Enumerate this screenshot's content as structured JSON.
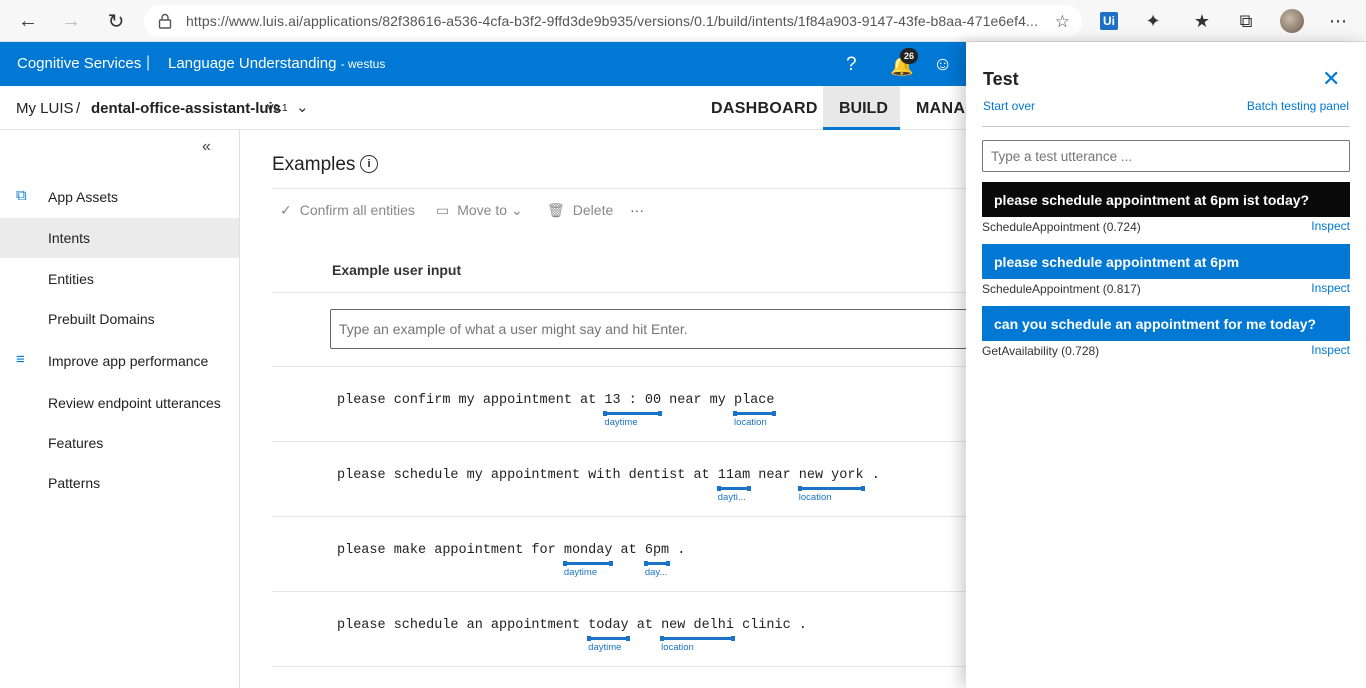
{
  "browser": {
    "url": "https://www.luis.ai/applications/82f38616-a536-4cfa-b3f2-9ffd3de9b935/versions/0.1/build/intents/1f84a903-9147-43fe-b8aa-471e6ef4...",
    "ext_label": "Ui"
  },
  "header": {
    "brand": "Cognitive Services",
    "separator": "|",
    "product": "Language Understanding",
    "region": "- westus",
    "notifications_count": "26"
  },
  "breadcrumb": {
    "root": "My LUIS",
    "separator": "/",
    "app_name": "dental-office-assistant-luis",
    "version": "V0.1"
  },
  "top_tabs": {
    "dashboard": "DASHBOARD",
    "build": "BUILD",
    "manage": "MANAG"
  },
  "sidebar": {
    "items": [
      {
        "label": "App Assets"
      },
      {
        "label": "Intents"
      },
      {
        "label": "Entities"
      },
      {
        "label": "Prebuilt Domains"
      },
      {
        "label": "Improve app performance"
      },
      {
        "label": "Review endpoint utterances"
      },
      {
        "label": "Features"
      },
      {
        "label": "Patterns"
      }
    ]
  },
  "main": {
    "title": "Examples",
    "toolbar": {
      "confirm": "Confirm all entities",
      "move": "Move to",
      "delete": "Delete",
      "more": "···"
    },
    "column_header": "Example user input",
    "input_placeholder": "Type an example of what a user might say and hit Enter.",
    "utterances": [
      {
        "parts": [
          {
            "text": "please confirm my appointment at "
          },
          {
            "text": "13 : 00",
            "entity": "daytime"
          },
          {
            "text": " near my "
          },
          {
            "text": "place",
            "entity": "location"
          }
        ]
      },
      {
        "parts": [
          {
            "text": "please schedule my appointment with dentist at "
          },
          {
            "text": "11am",
            "entity": "dayti..."
          },
          {
            "text": " near "
          },
          {
            "text": "new york",
            "entity": "location"
          },
          {
            "text": " ."
          }
        ]
      },
      {
        "parts": [
          {
            "text": "please make appointment for "
          },
          {
            "text": "monday",
            "entity": "daytime"
          },
          {
            "text": " at "
          },
          {
            "text": "6pm",
            "entity": "day..."
          },
          {
            "text": " ."
          }
        ]
      },
      {
        "parts": [
          {
            "text": "please schedule an appointment "
          },
          {
            "text": "today",
            "entity": "daytime"
          },
          {
            "text": " at "
          },
          {
            "text": "new delhi",
            "entity": "location"
          },
          {
            "text": " clinic ."
          }
        ]
      }
    ]
  },
  "test_panel": {
    "title": "Test",
    "start_over": "Start over",
    "batch": "Batch testing panel",
    "input_placeholder": "Type a test utterance ...",
    "results": [
      {
        "utterance": "please schedule appointment at 6pm ist today?",
        "intent": "ScheduleAppointment (0.724)",
        "inspect": "Inspect"
      },
      {
        "utterance": "please schedule appointment at 6pm",
        "intent": "ScheduleAppointment (0.817)",
        "inspect": "Inspect"
      },
      {
        "utterance": "can you schedule an appointment for me today?",
        "intent": "GetAvailability (0.728)",
        "inspect": "Inspect"
      }
    ]
  },
  "colors": {
    "accent": "#0078d4",
    "selected_result": "#0a0a0a",
    "entity": "#1a73c8"
  }
}
